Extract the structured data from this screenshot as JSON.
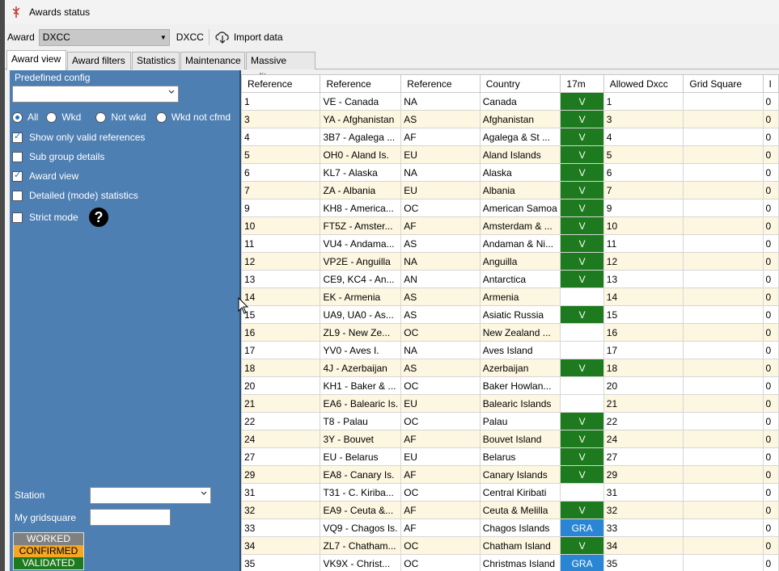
{
  "window": {
    "title": "Awards status"
  },
  "toolbar": {
    "award_label": "Award",
    "award_value": "DXCC",
    "award_name": "DXCC",
    "import_label": "Import data"
  },
  "tabs": [
    "Award view",
    "Award filters",
    "Statistics",
    "Maintenance",
    "Massive editor"
  ],
  "left": {
    "predefined_label": "Predefined config",
    "predefined_value": "",
    "radios": [
      {
        "label": "All",
        "checked": true
      },
      {
        "label": "Wkd",
        "checked": false
      },
      {
        "label": "Not wkd",
        "checked": false
      },
      {
        "label": "Wkd not cfmd",
        "checked": false
      }
    ],
    "checks": [
      {
        "label": "Show only valid references",
        "checked": true
      },
      {
        "label": "Sub group details",
        "checked": false
      },
      {
        "label": "Award view",
        "checked": true
      },
      {
        "label": "Detailed (mode) statistics",
        "checked": false
      },
      {
        "label": "Strict mode",
        "checked": false
      }
    ],
    "help_glyph": "?",
    "station_label": "Station",
    "station_value": "",
    "gridsquare_label": "My gridsquare",
    "gridsquare_value": "",
    "legend": {
      "worked": "WORKED",
      "confirmed": "CONFIRMED",
      "validated": "VALIDATED"
    }
  },
  "colors": {
    "pane": "#4e7fb2",
    "validated": "#1e7a1e",
    "confirmed": "#f5a623",
    "worked": "#808080",
    "gra": "#2a86d4",
    "row_alt": "#fdf6e0"
  },
  "table": {
    "columns": [
      "Reference",
      "Reference",
      "Reference",
      "Country",
      "17m",
      "Allowed Dxcc",
      "Grid Square",
      "I"
    ],
    "rows": [
      [
        "1",
        "VE - Canada",
        "NA",
        "Canada",
        "V",
        "1",
        "",
        "0"
      ],
      [
        "3",
        "YA - Afghanistan",
        "AS",
        "Afghanistan",
        "V",
        "3",
        "",
        "0"
      ],
      [
        "4",
        "3B7 - Agalega ...",
        "AF",
        "Agalega & St ...",
        "V",
        "4",
        "",
        "0"
      ],
      [
        "5",
        "OH0 - Aland Is.",
        "EU",
        "Aland Islands",
        "V",
        "5",
        "",
        "0"
      ],
      [
        "6",
        "KL7 - Alaska",
        "NA",
        "Alaska",
        "V",
        "6",
        "",
        "0"
      ],
      [
        "7",
        "ZA - Albania",
        "EU",
        "Albania",
        "V",
        "7",
        "",
        "0"
      ],
      [
        "9",
        "KH8 - America...",
        "OC",
        "American Samoa",
        "V",
        "9",
        "",
        "0"
      ],
      [
        "10",
        "FT5Z - Amster...",
        "AF",
        "Amsterdam & ...",
        "V",
        "10",
        "",
        "0"
      ],
      [
        "11",
        "VU4 - Andama...",
        "AS",
        "Andaman & Ni...",
        "V",
        "11",
        "",
        "0"
      ],
      [
        "12",
        "VP2E - Anguilla",
        "NA",
        "Anguilla",
        "V",
        "12",
        "",
        "0"
      ],
      [
        "13",
        "CE9, KC4 - An...",
        "AN",
        "Antarctica",
        "V",
        "13",
        "",
        "0"
      ],
      [
        "14",
        "EK - Armenia",
        "AS",
        "Armenia",
        "",
        "14",
        "",
        "0"
      ],
      [
        "15",
        "UA9, UA0 - As...",
        "AS",
        "Asiatic Russia",
        "V",
        "15",
        "",
        "0"
      ],
      [
        "16",
        "ZL9 - New Ze...",
        "OC",
        "New Zealand ...",
        "",
        "16",
        "",
        "0"
      ],
      [
        "17",
        "YV0 - Aves I.",
        "NA",
        "Aves Island",
        "",
        "17",
        "",
        "0"
      ],
      [
        "18",
        "4J - Azerbaijan",
        "AS",
        "Azerbaijan",
        "V",
        "18",
        "",
        "0"
      ],
      [
        "20",
        "KH1 - Baker & ...",
        "OC",
        "Baker Howlan...",
        "",
        "20",
        "",
        "0"
      ],
      [
        "21",
        "EA6 - Balearic Is.",
        "EU",
        "Balearic Islands",
        "",
        "21",
        "",
        "0"
      ],
      [
        "22",
        "T8 - Palau",
        "OC",
        "Palau",
        "V",
        "22",
        "",
        "0"
      ],
      [
        "24",
        "3Y - Bouvet",
        "AF",
        "Bouvet Island",
        "V",
        "24",
        "",
        "0"
      ],
      [
        "27",
        "EU - Belarus",
        "EU",
        "Belarus",
        "V",
        "27",
        "",
        "0"
      ],
      [
        "29",
        "EA8 - Canary Is.",
        "AF",
        "Canary Islands",
        "V",
        "29",
        "",
        "0"
      ],
      [
        "31",
        "T31 - C. Kiriba...",
        "OC",
        "Central Kiribati",
        "",
        "31",
        "",
        "0"
      ],
      [
        "32",
        "EA9 - Ceuta &...",
        "AF",
        "Ceuta & Melilla",
        "V",
        "32",
        "",
        "0"
      ],
      [
        "33",
        "VQ9 - Chagos Is.",
        "AF",
        "Chagos Islands",
        "GRA",
        "33",
        "",
        "0"
      ],
      [
        "34",
        "ZL7 - Chatham...",
        "OC",
        "Chatham Island",
        "V",
        "34",
        "",
        "0"
      ],
      [
        "35",
        "VK9X - Christ...",
        "OC",
        "Christmas Island",
        "GRA",
        "35",
        "",
        "0"
      ]
    ]
  }
}
